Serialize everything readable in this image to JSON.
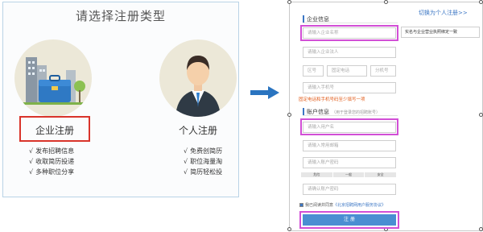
{
  "left": {
    "title": "请选择注册类型",
    "enterprise": {
      "label": "企业注册",
      "features": [
        "发布招聘信息",
        "收取简历投递",
        "多种职位分享"
      ]
    },
    "personal": {
      "label": "个人注册",
      "features": [
        "免费创简历",
        "职位海量淘",
        "简历轻松投"
      ]
    },
    "check_glyph": "√"
  },
  "form": {
    "switch_link": "切换为个人注册>>",
    "company_section": "企业信息",
    "company_name_placeholder": "请输入企业名称",
    "legal_person_placeholder": "请输入企业法人",
    "area_code_placeholder": "区号",
    "phone_placeholder": "固定电话",
    "ext_placeholder": "分机号",
    "mobile_placeholder": "请输入手机号",
    "side_button": "实名与企业营业执照绑定一致",
    "phone_warning": "固定电话和手机号码至少填写一项",
    "account_section": "账户信息",
    "account_hint": "（用于登录您的招聘账号）",
    "username_placeholder": "请输入用户名",
    "email_placeholder": "请输入常用邮箱",
    "password_placeholder": "请输入账户密码",
    "strength": [
      "危险",
      "一般",
      "安全"
    ],
    "confirm_placeholder": "请确认账户密码",
    "agree_text": "我已阅读并同意",
    "agree_link": "《北京招聘网用户服务协议》",
    "submit": "注 册"
  },
  "colors": {
    "highlight_red": "#d9342b",
    "highlight_magenta": "#d24fd6",
    "accent_blue": "#3b76c4",
    "arrow_blue": "#2a74c0"
  }
}
